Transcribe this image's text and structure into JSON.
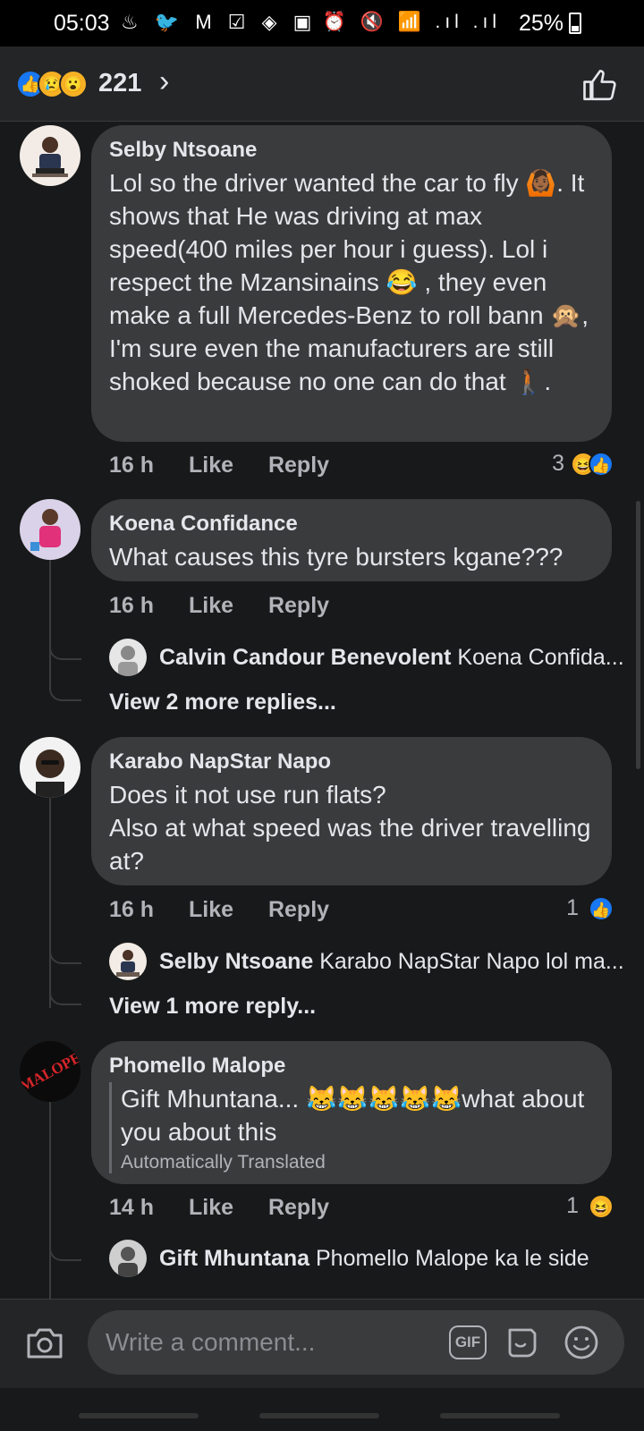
{
  "status_bar": {
    "time": "05:03",
    "notification_icons": "♨ 🐦 M ☑ ◈ ▣",
    "right_icons": "⏰ 🔇 📶 .ıl .ıl",
    "battery": "25%"
  },
  "header": {
    "reaction_count": "221",
    "reactions": [
      "like",
      "sad",
      "wow"
    ]
  },
  "comments": [
    {
      "author": "Selby Ntsoane",
      "text": "Lol so the driver wanted the car to fly 🙆🏾. It shows that He was driving at max speed(400 miles per hour i guess). Lol i respect the Mzansinains 😂 , they even make a full Mercedes-Benz to roll bann 🙊, I'm sure even the manufacturers are still shoked because no one can do that 🚶🏾.",
      "time": "16 h",
      "like": "Like",
      "reply": "Reply",
      "reaction_count": "3",
      "reactions": [
        "laugh",
        "like"
      ]
    },
    {
      "author": "Koena Confidance",
      "text": "What causes this tyre bursters kgane???",
      "time": "16 h",
      "like": "Like",
      "reply": "Reply",
      "reply_preview": {
        "author": "Calvin Candour Benevolent",
        "text": "Koena Confida..."
      },
      "view_more": "View 2 more replies..."
    },
    {
      "author": "Karabo NapStar Napo",
      "text": "Does it not use run flats?\nAlso at what speed was the driver travelling at?",
      "time": "16 h",
      "like": "Like",
      "reply": "Reply",
      "reaction_count": "1",
      "reactions": [
        "like"
      ],
      "reply_preview": {
        "author": "Selby Ntsoane",
        "text": "Karabo NapStar Napo lol ma..."
      },
      "view_more": "View 1 more reply..."
    },
    {
      "author": "Phomello Malope",
      "text": "Gift Mhuntana... 😹😹😹😹😹what about you about this",
      "translated": "Automatically Translated",
      "avatar_text": "MALOPE",
      "time": "14 h",
      "like": "Like",
      "reply": "Reply",
      "reaction_count": "1",
      "reactions": [
        "laugh"
      ],
      "reply_preview": {
        "author": "Gift Mhuntana",
        "text": "Phomello Malope ka le side"
      }
    }
  ],
  "composer": {
    "placeholder": "Write a comment...",
    "gif_label": "GIF"
  },
  "colors": {
    "background": "#18191a",
    "bubble": "#3a3b3c",
    "like_blue": "#1877f2",
    "emoji_yellow": "#f7b125"
  }
}
